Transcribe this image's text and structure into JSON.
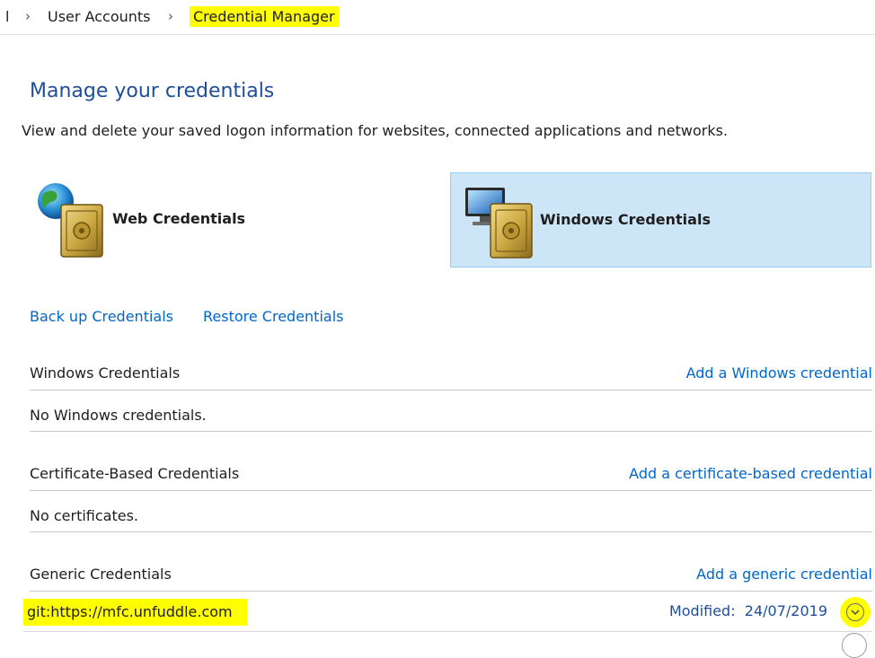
{
  "breadcrumb": {
    "clipped_prefix": "l",
    "separator": "›",
    "items": [
      "User Accounts",
      "Credential Manager"
    ]
  },
  "page": {
    "title": "Manage your credentials",
    "description": "View and delete your saved logon information for websites, connected applications and networks."
  },
  "tiles": {
    "web": {
      "label": "Web Credentials",
      "icon": "globe-safe-icon"
    },
    "windows": {
      "label": "Windows Credentials",
      "icon": "monitor-safe-icon",
      "selected": true
    }
  },
  "actions": {
    "backup": "Back up Credentials",
    "restore": "Restore Credentials"
  },
  "sections": {
    "windows": {
      "title": "Windows Credentials",
      "add_link": "Add a Windows credential",
      "empty_text": "No Windows credentials."
    },
    "certificate": {
      "title": "Certificate-Based Credentials",
      "add_link": "Add a certificate-based credential",
      "empty_text": "No certificates."
    },
    "generic": {
      "title": "Generic Credentials",
      "add_link": "Add a generic credential",
      "items": [
        {
          "name": "git:https://mfc.unfuddle.com",
          "modified_label": "Modified:",
          "modified_date": "24/07/2019"
        }
      ]
    }
  },
  "colors": {
    "link": "#0066cc",
    "title": "#1f4e99",
    "selected_tile_bg": "#cde6f7",
    "highlight": "#ffff00"
  }
}
